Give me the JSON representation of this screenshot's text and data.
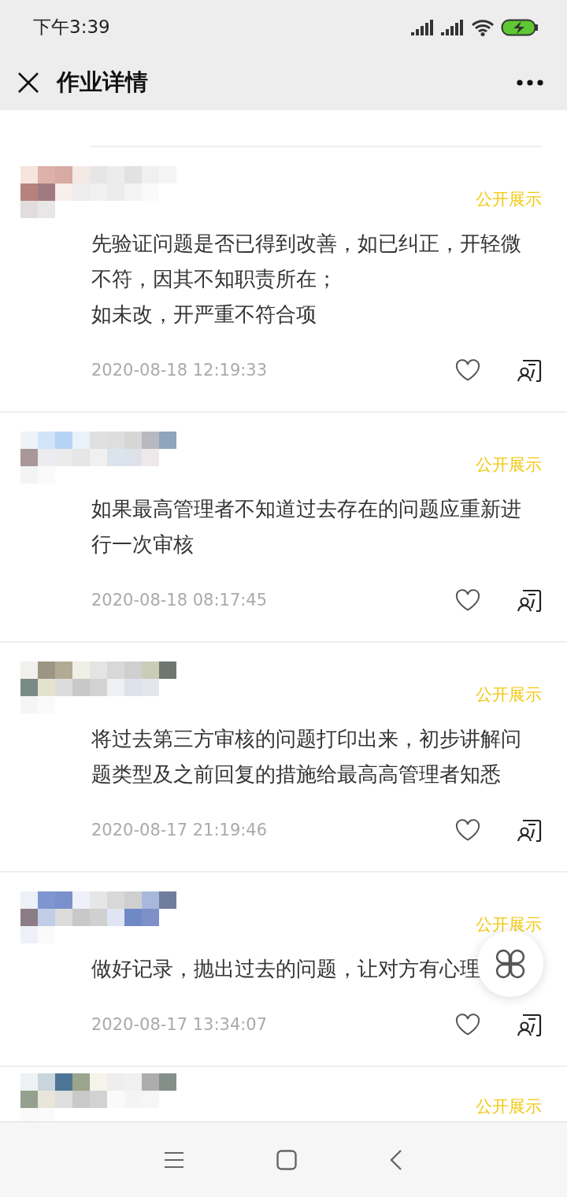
{
  "status_bar": {
    "time": "下午3:39"
  },
  "header": {
    "title": "作业详情"
  },
  "comments": [
    {
      "avatar": {
        "kind": "picture"
      },
      "visibility": "公开展示",
      "text": [
        "先验证问题是否已得到改善，如已纠正，开轻微不符，因其不知职责所在；",
        "如未改，开严重不符合项"
      ],
      "time": "2020-08-18 12:19:33",
      "liked": false
    },
    {
      "avatar": {
        "kind": "picture"
      },
      "visibility": "公开展示",
      "text": [
        "如果最高管理者不知道过去存在的问题应重新进行一次审核"
      ],
      "time": "2020-08-18 08:17:45",
      "liked": false
    },
    {
      "avatar": {
        "kind": "picture"
      },
      "visibility": "公开展示",
      "text": [
        "将过去第三方审核的问题打印出来，初步讲解问题类型及之前回复的措施给最高高管理者知悉"
      ],
      "time": "2020-08-17 21:19:46",
      "liked": false
    },
    {
      "avatar": {
        "kind": "picture"
      },
      "visibility": "公开展示",
      "text": [
        "做好记录，抛出过去的问题，让对方有心理"
      ],
      "time": "2020-08-17 13:34:07",
      "liked": false
    },
    {
      "avatar": {
        "kind": "picture"
      },
      "visibility": "公开展示"
    }
  ]
}
